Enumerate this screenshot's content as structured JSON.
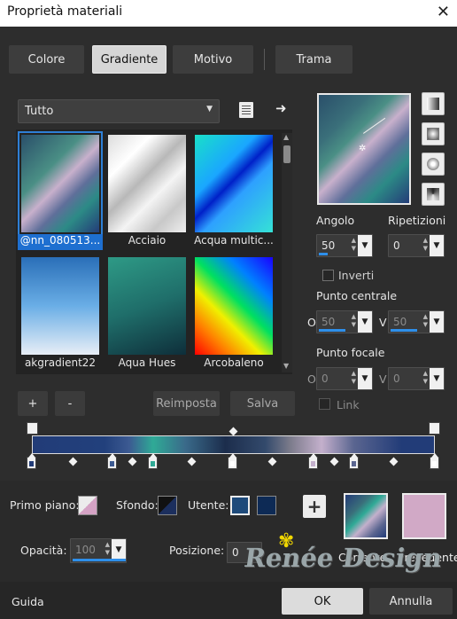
{
  "window": {
    "title": "Proprietà materiali",
    "close_icon": "✕"
  },
  "tabs": [
    {
      "label": "Colore",
      "active": false
    },
    {
      "label": "Gradiente",
      "active": true
    },
    {
      "label": "Motivo",
      "active": false
    },
    {
      "label": "Trama",
      "active": false
    }
  ],
  "library": {
    "category": "Tutto",
    "items": [
      {
        "label": "@nn_080513...",
        "selected": true
      },
      {
        "label": "Acciaio",
        "selected": false
      },
      {
        "label": "Acqua multic...",
        "selected": false
      },
      {
        "label": "akgradient22",
        "selected": false
      },
      {
        "label": "Aqua Hues",
        "selected": false
      },
      {
        "label": "Arcobaleno",
        "selected": false
      }
    ]
  },
  "stop_buttons": {
    "add": "+",
    "remove": "-",
    "reset": "Reimposta",
    "save": "Salva"
  },
  "params": {
    "angle_label": "Angolo",
    "angle_value": "50",
    "repeat_label": "Ripetizioni",
    "repeat_value": "0",
    "invert_label": "Inverti",
    "invert_checked": false,
    "center_label": "Punto centrale",
    "center_o_label": "O",
    "center_o_value": "50",
    "center_v_label": "V",
    "center_v_value": "50",
    "focal_label": "Punto focale",
    "focal_o_label": "O",
    "focal_o_value": "0",
    "focal_v_label": "V",
    "focal_v_value": "0",
    "link_label": "Link",
    "link_checked": false
  },
  "bottom": {
    "foreground_label": "Primo piano:",
    "background_label": "Sfondo:",
    "user_label": "Utente:",
    "user_colors": [
      "#1e4a7a",
      "#0d2a55"
    ],
    "opacity_label": "Opacità:",
    "opacity_value": "100",
    "position_label": "Posizione:",
    "position_value": "0",
    "current_label": "Corrente",
    "previous_label": "Precedente",
    "previous_color": "#d1a9c6",
    "watermark": "Renée Design"
  },
  "footer": {
    "help": "Guida",
    "ok": "OK",
    "cancel": "Annulla"
  },
  "colors": {
    "accent": "#1e6fd0",
    "stop_pink": "#c4b0cc",
    "stop_teal": "#2faa96",
    "stop_navy": "#223c78"
  }
}
